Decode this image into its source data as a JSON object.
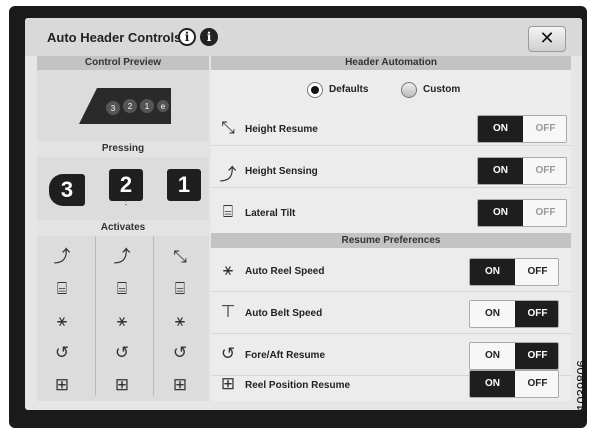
{
  "window": {
    "title": "Auto Header Controls",
    "info_icons": [
      "info-outline-icon",
      "info-filled-icon"
    ],
    "close_label": "✕"
  },
  "left": {
    "preview_header": "Control Preview",
    "preview_buttons": [
      "3",
      "2",
      "1",
      "e"
    ],
    "pressing_header": "Pressing",
    "pressing_buttons": [
      "3",
      "2",
      "1"
    ],
    "activates_header": "Activates",
    "activates_columns": [
      [
        "height-sensing-icon",
        "lateral-tilt-icon",
        "auto-reel-speed-icon",
        "fore-aft-resume-icon",
        "reel-position-resume-icon"
      ],
      [
        "height-sensing-icon",
        "lateral-tilt-icon",
        "auto-reel-speed-icon",
        "fore-aft-resume-icon",
        "reel-position-resume-icon"
      ],
      [
        "height-resume-icon",
        "lateral-tilt-icon",
        "auto-reel-speed-icon",
        "fore-aft-resume-icon",
        "reel-position-resume-icon"
      ]
    ]
  },
  "right": {
    "header_automation": "Header Automation",
    "mode": {
      "defaults_label": "Defaults",
      "custom_label": "Custom",
      "selected": "Defaults"
    },
    "automation_rows": [
      {
        "label": "Height Resume",
        "icon": "height-resume-icon",
        "on": "ON",
        "off": "OFF",
        "value": "ON"
      },
      {
        "label": "Height Sensing",
        "icon": "height-sensing-icon",
        "on": "ON",
        "off": "OFF",
        "value": "ON"
      },
      {
        "label": "Lateral Tilt",
        "icon": "lateral-tilt-icon",
        "on": "ON",
        "off": "OFF",
        "value": "ON"
      }
    ],
    "resume_preferences": "Resume Preferences",
    "resume_rows": [
      {
        "label": "Auto Reel Speed",
        "icon": "auto-reel-speed-icon",
        "on": "ON",
        "off": "OFF",
        "value": "ON"
      },
      {
        "label": "Auto Belt Speed",
        "icon": "auto-belt-speed-icon",
        "on": "ON",
        "off": "OFF",
        "value": "OFF"
      },
      {
        "label": "Fore/Aft Resume",
        "icon": "fore-aft-resume-icon",
        "on": "ON",
        "off": "OFF",
        "value": "OFF"
      },
      {
        "label": "Reel Position Resume",
        "icon": "reel-position-resume-icon",
        "on": "ON",
        "off": "OFF",
        "value": "ON"
      }
    ]
  },
  "figure_id": "1039806",
  "colors": {
    "bezel": "#1a1a1a",
    "selected": "#1e1e1e",
    "header_band": "#c3c3c3"
  }
}
